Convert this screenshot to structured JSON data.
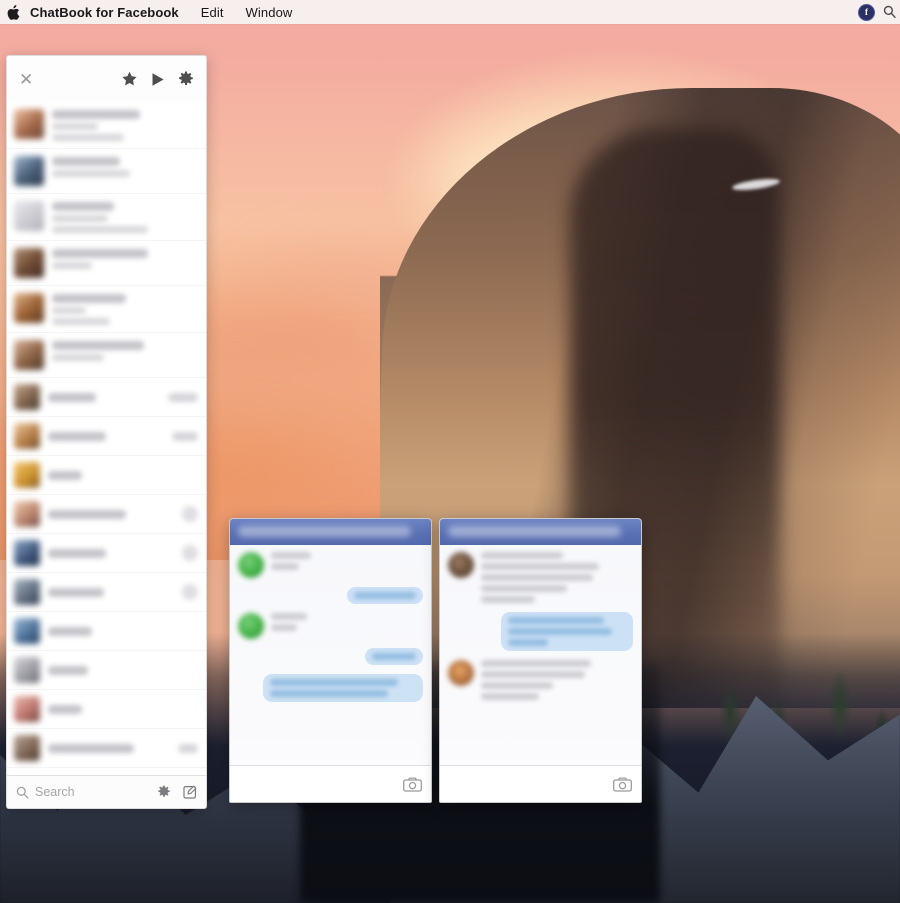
{
  "menubar": {
    "apple_glyph": "",
    "apple_icon": "apple-logo-icon",
    "app_name": "ChatBook for Facebook",
    "items": [
      {
        "label": "Edit"
      },
      {
        "label": "Window"
      }
    ],
    "status_items": [
      {
        "icon": "chatbook-menu-badge-icon",
        "label": "f"
      },
      {
        "icon": "spotlight-search-icon",
        "label": ""
      }
    ]
  },
  "sidebar": {
    "close_label": "✕",
    "header_icons": [
      {
        "name": "favorites-star-icon",
        "glyph": "★"
      },
      {
        "name": "play-triangle-icon",
        "glyph": "▶"
      },
      {
        "name": "settings-gear-icon",
        "glyph": "⚙"
      }
    ],
    "conversations": [
      {
        "type": "full",
        "avatar": "skin",
        "title_w": 88,
        "sub_w": 46,
        "body_w": 72,
        "body2_w": 0,
        "meta": "none"
      },
      {
        "type": "full",
        "avatar": "blue",
        "title_w": 68,
        "sub_w": 78,
        "body_w": 0,
        "body2_w": 0,
        "meta": "none"
      },
      {
        "type": "full",
        "avatar": "pale",
        "title_w": 62,
        "sub_w": 56,
        "body_w": 96,
        "body2_w": 0,
        "meta": "none"
      },
      {
        "type": "full",
        "avatar": "dark",
        "title_w": 96,
        "sub_w": 40,
        "body_w": 0,
        "body2_w": 0,
        "meta": "none"
      },
      {
        "type": "full",
        "avatar": "brown",
        "title_w": 74,
        "sub_w": 34,
        "body_w": 58,
        "body2_w": 0,
        "meta": "none"
      },
      {
        "type": "full",
        "avatar": "tan",
        "title_w": 92,
        "sub_w": 52,
        "body_w": 0,
        "body2_w": 0,
        "meta": "none"
      },
      {
        "type": "compact",
        "avatar": "mix",
        "title_w": 48,
        "meta": "chip",
        "meta_w": 30
      },
      {
        "type": "compact",
        "avatar": "warm",
        "title_w": 58,
        "meta": "chip",
        "meta_w": 26
      },
      {
        "type": "compact",
        "avatar": "gold",
        "title_w": 34,
        "meta": "none"
      },
      {
        "type": "compact",
        "avatar": "skin2",
        "title_w": 78,
        "meta": "dot"
      },
      {
        "type": "compact",
        "avatar": "navy",
        "title_w": 58,
        "meta": "dot"
      },
      {
        "type": "compact",
        "avatar": "steel",
        "title_w": 56,
        "meta": "dot"
      },
      {
        "type": "compact",
        "avatar": "blue2",
        "title_w": 44,
        "meta": "none"
      },
      {
        "type": "compact",
        "avatar": "grey",
        "title_w": 40,
        "meta": "none"
      },
      {
        "type": "compact",
        "avatar": "rose",
        "title_w": 34,
        "meta": "none"
      },
      {
        "type": "compact",
        "avatar": "dusk",
        "title_w": 86,
        "meta": "chip",
        "meta_w": 20
      }
    ],
    "footer": {
      "search_placeholder": "Search",
      "search_value": "",
      "search_icon": "magnifier-icon",
      "gear_icon": "settings-gear-icon",
      "compose_icon": "compose-new-message-icon"
    }
  },
  "chat_windows": [
    {
      "name": "chat-window-1",
      "camera_icon": "camera-attachment-icon",
      "messages": [
        {
          "dir": "in",
          "avatar": "green",
          "lines": [
            40,
            28
          ]
        },
        {
          "dir": "out",
          "lines": [
            62
          ]
        },
        {
          "dir": "in",
          "avatar": "green",
          "lines": [
            36,
            26
          ]
        },
        {
          "dir": "out",
          "lines": [
            44
          ]
        },
        {
          "dir": "out",
          "lines": [
            128,
            118
          ]
        }
      ]
    },
    {
      "name": "chat-window-2",
      "camera_icon": "camera-attachment-icon",
      "messages": [
        {
          "dir": "in",
          "avatar": "photo1",
          "lines": [
            82,
            118,
            112,
            86,
            54
          ]
        },
        {
          "dir": "out",
          "lines": [
            96,
            104,
            40
          ]
        },
        {
          "dir": "in",
          "avatar": "photo2",
          "lines": [
            110,
            104,
            72,
            58
          ]
        }
      ]
    }
  ],
  "colors": {
    "titlebar_blue": "#5a71b4",
    "outgoing_bubble": "#c5ddf4",
    "incoming_bubble": "#e8e9ee",
    "menubar_bg": "#f6f4f3",
    "panel_bg": "#fdfdfd",
    "avatar_green": "#3fae44"
  }
}
